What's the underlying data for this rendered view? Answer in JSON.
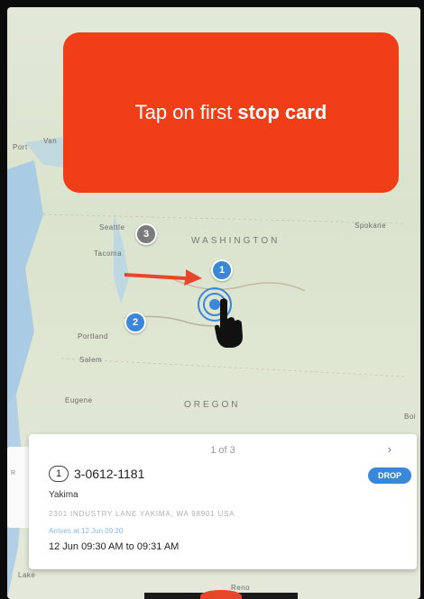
{
  "tooltip": {
    "prefix": "Tap on first ",
    "bold": "stop card"
  },
  "map": {
    "labels": {
      "state1": "WASHINGTON",
      "state2": "OREGON",
      "seattle": "Seattle",
      "tacoma": "Tacoma",
      "spokane": "Spokane",
      "portland": "Portland",
      "salem": "Salem",
      "eugene": "Eugene",
      "van": "Van",
      "port": "Port",
      "boi": "Boi",
      "lake": "Lake",
      "reno": "Reno"
    },
    "pins": [
      {
        "number": "1",
        "color": "#3a86d8"
      },
      {
        "number": "2",
        "color": "#3a86d8"
      },
      {
        "number": "3",
        "color": "#7b7b7b"
      }
    ]
  },
  "card": {
    "pager": "1 of 3",
    "next_icon": "›",
    "stop_number": "1",
    "stop_id": "3-0612-1181",
    "badge": "DROP",
    "city": "Yakima",
    "address": "2301 INDUSTRY LANE YAKIMA, WA 98901 USA",
    "detail": "Arrives at 12 Jun 09:30",
    "time": "12 Jun 09:30 AM to 09:31 AM"
  },
  "colors": {
    "accent": "#f03e18",
    "pin_blue": "#3a86d8",
    "arrow": "#e8452a"
  }
}
